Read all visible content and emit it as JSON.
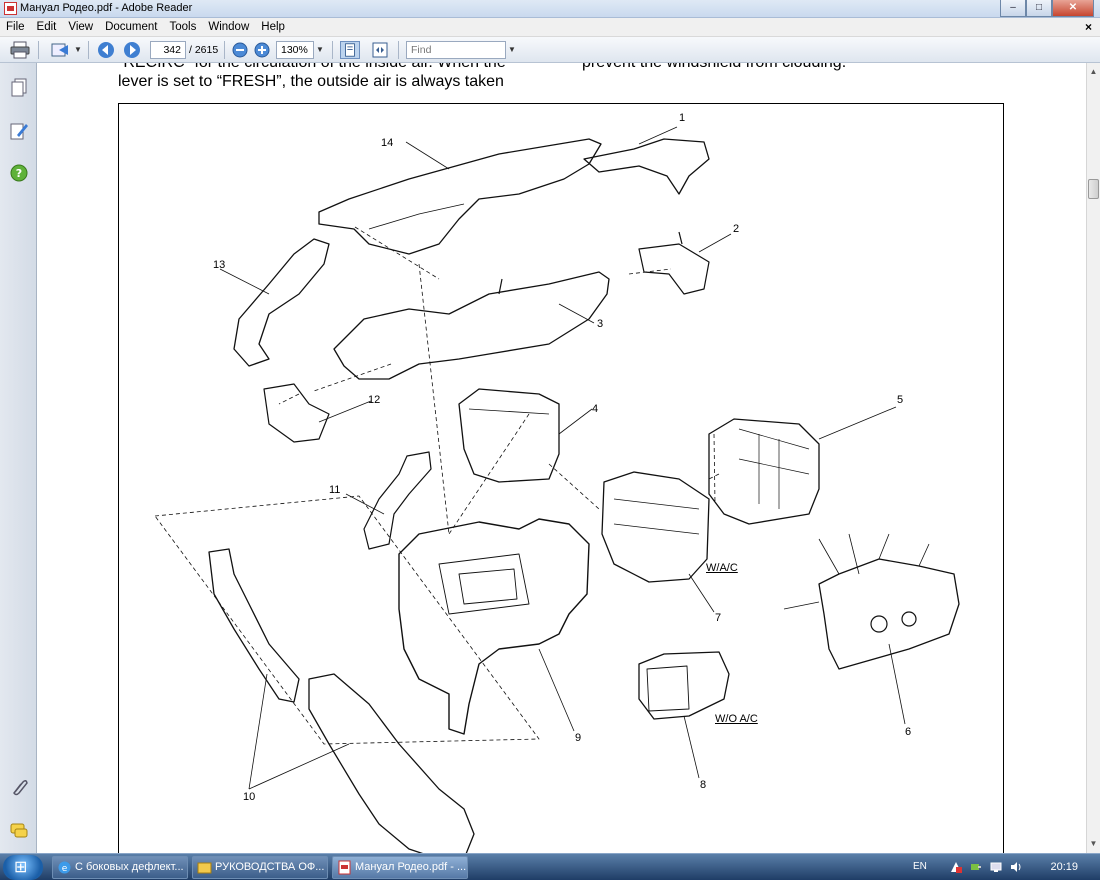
{
  "window": {
    "title": "Мануал Родео.pdf - Adobe Reader"
  },
  "menu": [
    "File",
    "Edit",
    "View",
    "Document",
    "Tools",
    "Window",
    "Help"
  ],
  "toolbar": {
    "page_current": "342",
    "page_total": "/ 2615",
    "zoom": "130%",
    "find_placeholder": "Find"
  },
  "document": {
    "text_line1_left": "“RECIRC” for the circulation of the inside air. When the",
    "text_line2_left": "lever is set to “FRESH”, the outside air is always taken",
    "text_line1_right": "prevent the windshield from clouding.",
    "figure": {
      "part_labels": [
        "1",
        "2",
        "3",
        "4",
        "5",
        "6",
        "7",
        "8",
        "9",
        "10",
        "11",
        "12",
        "13",
        "14"
      ],
      "variant_labels": {
        "with_ac": "W/A/C",
        "without_ac": "W/O A/C"
      }
    }
  },
  "taskbar": {
    "tasks": [
      {
        "label": "С боковых дефлект..."
      },
      {
        "label": "РУКОВОДСТВА ОФ..."
      },
      {
        "label": "Мануал Родео.pdf - ..."
      }
    ],
    "language": "EN",
    "clock": "20:19"
  },
  "colors": {
    "titlebar": "#c9d9ee",
    "taskbar": "#1f3d66",
    "close_button": "#c6452f"
  }
}
